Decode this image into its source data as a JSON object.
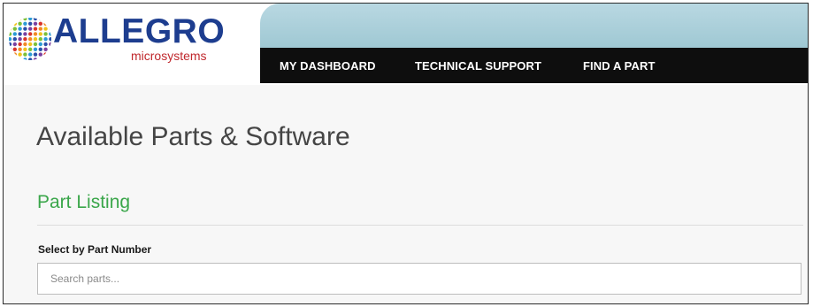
{
  "brand": {
    "name": "ALLEGRO",
    "subtitle": "microsystems",
    "name_color": "#1d3d8f",
    "subtitle_color": "#c0282d"
  },
  "nav": {
    "items": [
      {
        "label": "MY DASHBOARD"
      },
      {
        "label": "TECHNICAL SUPPORT"
      },
      {
        "label": "FIND A PART"
      }
    ]
  },
  "page": {
    "title": "Available Parts & Software",
    "section_title": "Part Listing",
    "section_color": "#3aa64a"
  },
  "search": {
    "label": "Select by Part Number",
    "placeholder": "Search parts...",
    "value": ""
  }
}
